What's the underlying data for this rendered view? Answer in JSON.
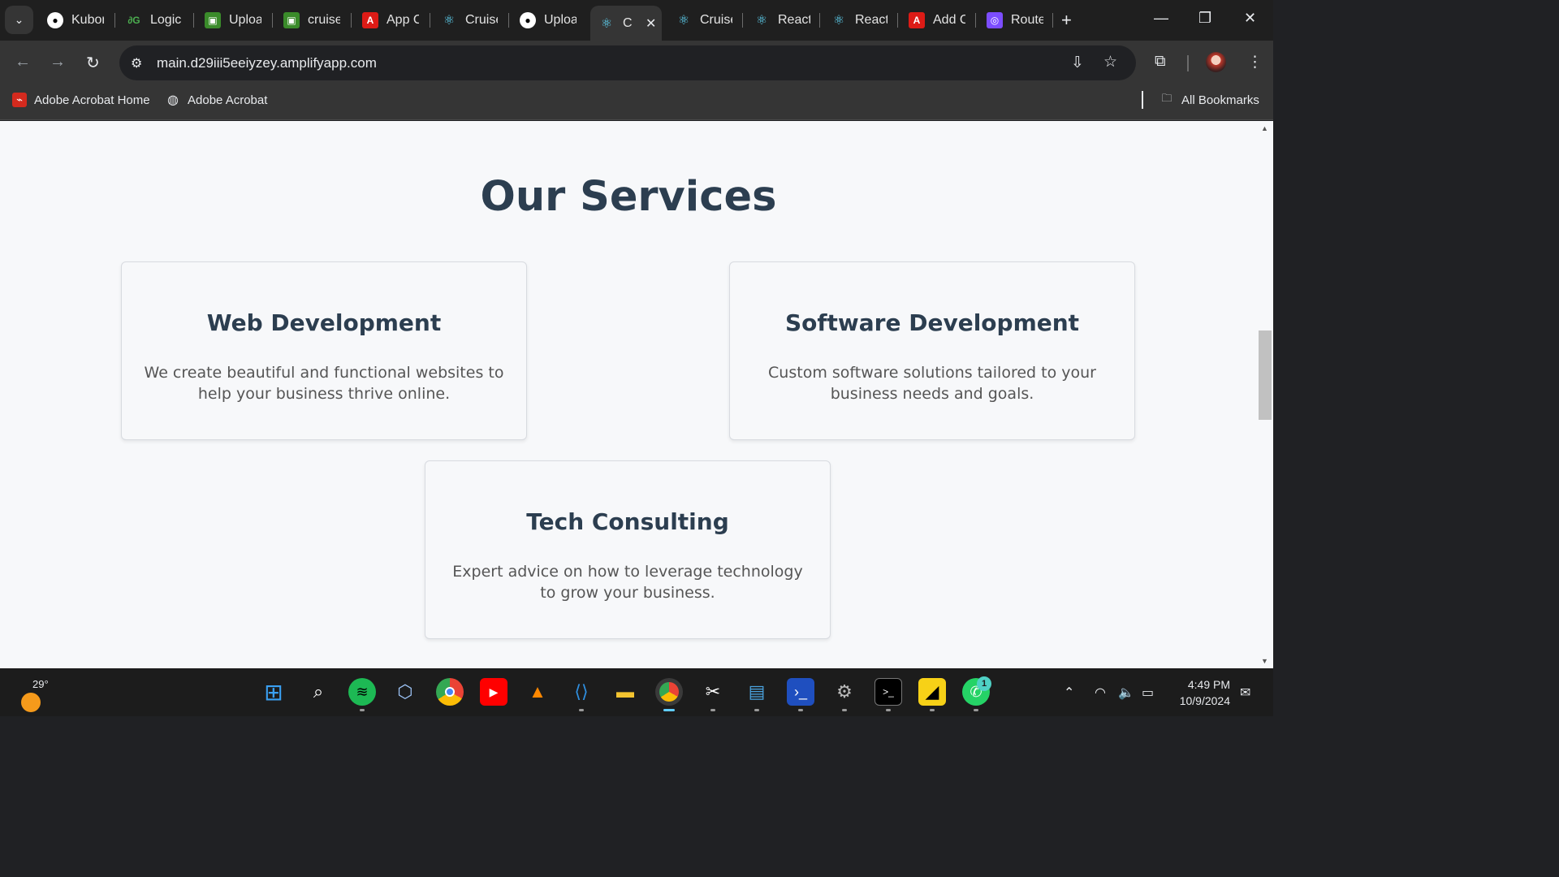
{
  "tabs": [
    {
      "label": "Kubor",
      "icon": "github-icon"
    },
    {
      "label": "Logic",
      "icon": "logic-icon"
    },
    {
      "label": "Uploa",
      "icon": "green-doc-icon"
    },
    {
      "label": "cruise",
      "icon": "green-doc-icon"
    },
    {
      "label": "App C",
      "icon": "angular-icon"
    },
    {
      "label": "Cruise",
      "icon": "react-icon"
    },
    {
      "label": "Uploa",
      "icon": "github-icon"
    },
    {
      "label": "C",
      "icon": "react-icon",
      "active": true
    },
    {
      "label": "Cruise",
      "icon": "react-icon"
    },
    {
      "label": "React",
      "icon": "react-icon"
    },
    {
      "label": "React",
      "icon": "react-icon"
    },
    {
      "label": "Add C",
      "icon": "angular-icon"
    },
    {
      "label": "Route",
      "icon": "route-icon"
    }
  ],
  "address_bar": {
    "url": "main.d29iii5eeiyzey.amplifyapp.com"
  },
  "bookmarks": {
    "items": [
      {
        "label": "Adobe Acrobat Home",
        "icon": "acrobat-icon"
      },
      {
        "label": "Adobe Acrobat",
        "icon": "globe-icon"
      }
    ],
    "all_bookmarks": "All Bookmarks"
  },
  "page": {
    "title": "Our Services",
    "services": [
      {
        "title": "Web Development",
        "description": "We create beautiful and functional websites to help your business thrive online."
      },
      {
        "title": "Software Development",
        "description": "Custom software solutions tailored to your business needs and goals."
      },
      {
        "title": "Tech Consulting",
        "description": "Expert advice on how to leverage technology to grow your business."
      }
    ]
  },
  "taskbar": {
    "weather_temp": "29°",
    "time": "4:49 PM",
    "date": "10/9/2024",
    "whatsapp_badge": "1"
  },
  "colors": {
    "title_text": "#2c3e50",
    "body_text": "#555555",
    "page_bg": "#f7f8fa",
    "chrome_dark": "#353535"
  }
}
